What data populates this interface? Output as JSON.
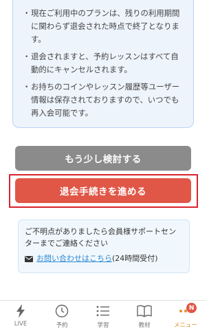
{
  "notice": {
    "items": [
      {
        "bullet": "・",
        "text": "現在ご利用中のプランは、残りの利用期間に関わらず退会された時点で終了となります。"
      },
      {
        "bullet": "・",
        "text": "退会されますと、予約レッスンはすべて自動的にキャンセルされます。"
      },
      {
        "bullet": "・",
        "text": "お持ちのコインやレッスン履歴等ユーザー情報は保存されておりますので、いつでも再入会可能です。"
      }
    ]
  },
  "buttons": {
    "consider_label": "もう少し検討する",
    "proceed_label": "退会手続きを進める"
  },
  "support": {
    "text": "ご不明点がありましたら会員様サポートセンターまでご連絡ください",
    "link_label": "お問い合わせはこちら",
    "hours": "(24時間受付)"
  },
  "tabbar": {
    "tabs": [
      {
        "label": "LIVE",
        "icon": "lightning-icon"
      },
      {
        "label": "予約",
        "icon": "clock-icon"
      },
      {
        "label": "学習",
        "icon": "list-icon"
      },
      {
        "label": "教材",
        "icon": "book-icon"
      },
      {
        "label": "メニュー",
        "icon": "menu-dots-icon",
        "badge": "N"
      }
    ]
  },
  "colors": {
    "proceed_button": "#e05747",
    "consider_button": "#8b8b8b",
    "highlight_frame": "#d9232d",
    "link": "#2d88cf",
    "active_tab": "#e0902a"
  }
}
